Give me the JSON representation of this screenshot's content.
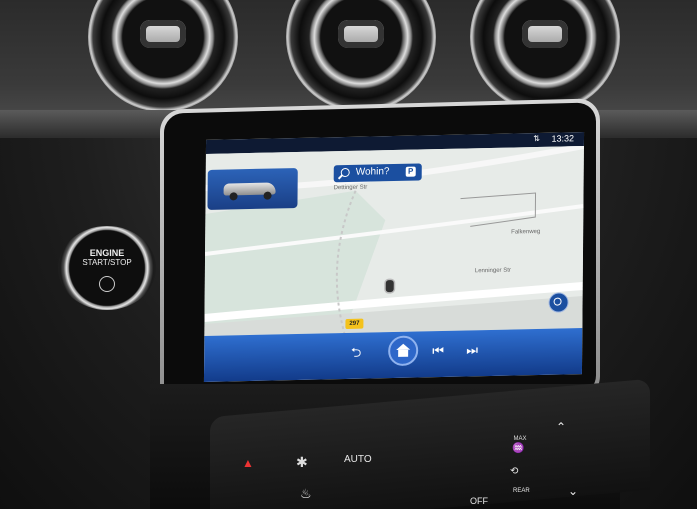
{
  "start_button": {
    "line1": "ENGINE",
    "line2": "START/STOP"
  },
  "status": {
    "time": "13:32",
    "signal_icon": "signal-icon"
  },
  "search": {
    "label": "Wohin?",
    "icon": "search-icon",
    "parking_label": "P"
  },
  "map": {
    "streets": [
      "Dettinger Str",
      "Falkenweg",
      "Lenninger Str"
    ],
    "route_number": "297"
  },
  "bottom_bar": {
    "buttons": [
      "back-icon",
      "home-icon",
      "previous-track-icon",
      "next-track-icon"
    ]
  },
  "console": {
    "auto_label": "AUTO",
    "off_label": "OFF",
    "max_label": "MAX",
    "rear_label": "REAR"
  }
}
